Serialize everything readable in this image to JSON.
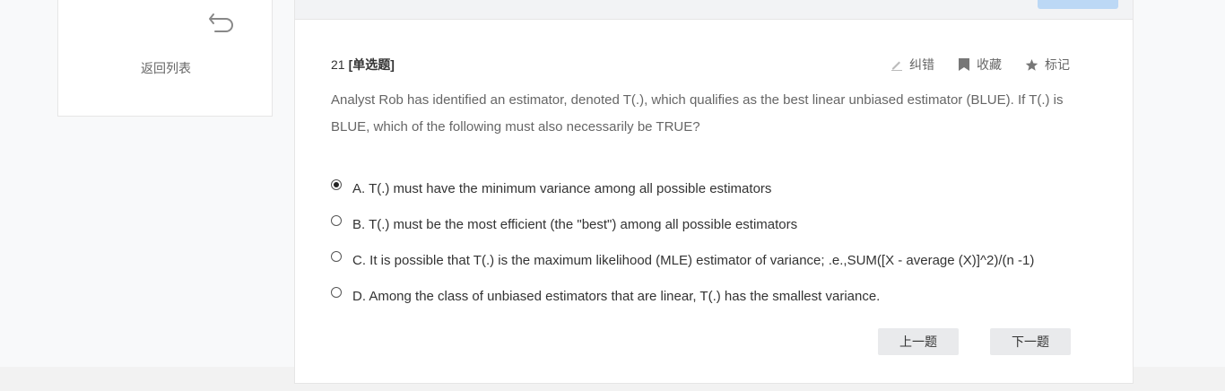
{
  "sidebar": {
    "back_label": "返回列表",
    "back_icon": "undo-arrow-icon"
  },
  "question": {
    "number": "21",
    "type": "[单选题]",
    "text": "Analyst Rob has identified an estimator, denoted T(.), which qualifies as the best linear unbiased estimator (BLUE). If T(.) is BLUE, which of the following must also necessarily be TRUE?",
    "selected_option": "A",
    "options": [
      {
        "label": "A. T(.) must have the minimum variance among all possible estimators"
      },
      {
        "label": "B. T(.) must be the most efficient (the \"best\") among all possible estimators"
      },
      {
        "label": "C. It is possible that T(.) is the maximum likelihood (MLE) estimator of variance; .e.,SUM([X - average (X)]^2)/(n -1)"
      },
      {
        "label": "D. Among the class of unbiased estimators that are linear, T(.) has the smallest variance."
      }
    ]
  },
  "tools": {
    "correct_label": "纠错",
    "favorite_label": "收藏",
    "mark_label": "标记",
    "correct_icon": "pencil-icon",
    "favorite_icon": "bookmark-icon",
    "mark_icon": "star-icon"
  },
  "navigation": {
    "prev_label": "上一题",
    "next_label": "下一题"
  },
  "colors": {
    "background": "#f8f9fa",
    "card": "#ffffff",
    "border": "#e6e6e6",
    "button": "#e9eaec",
    "header_button": "#bcd8f5",
    "muted_text": "#666666"
  }
}
